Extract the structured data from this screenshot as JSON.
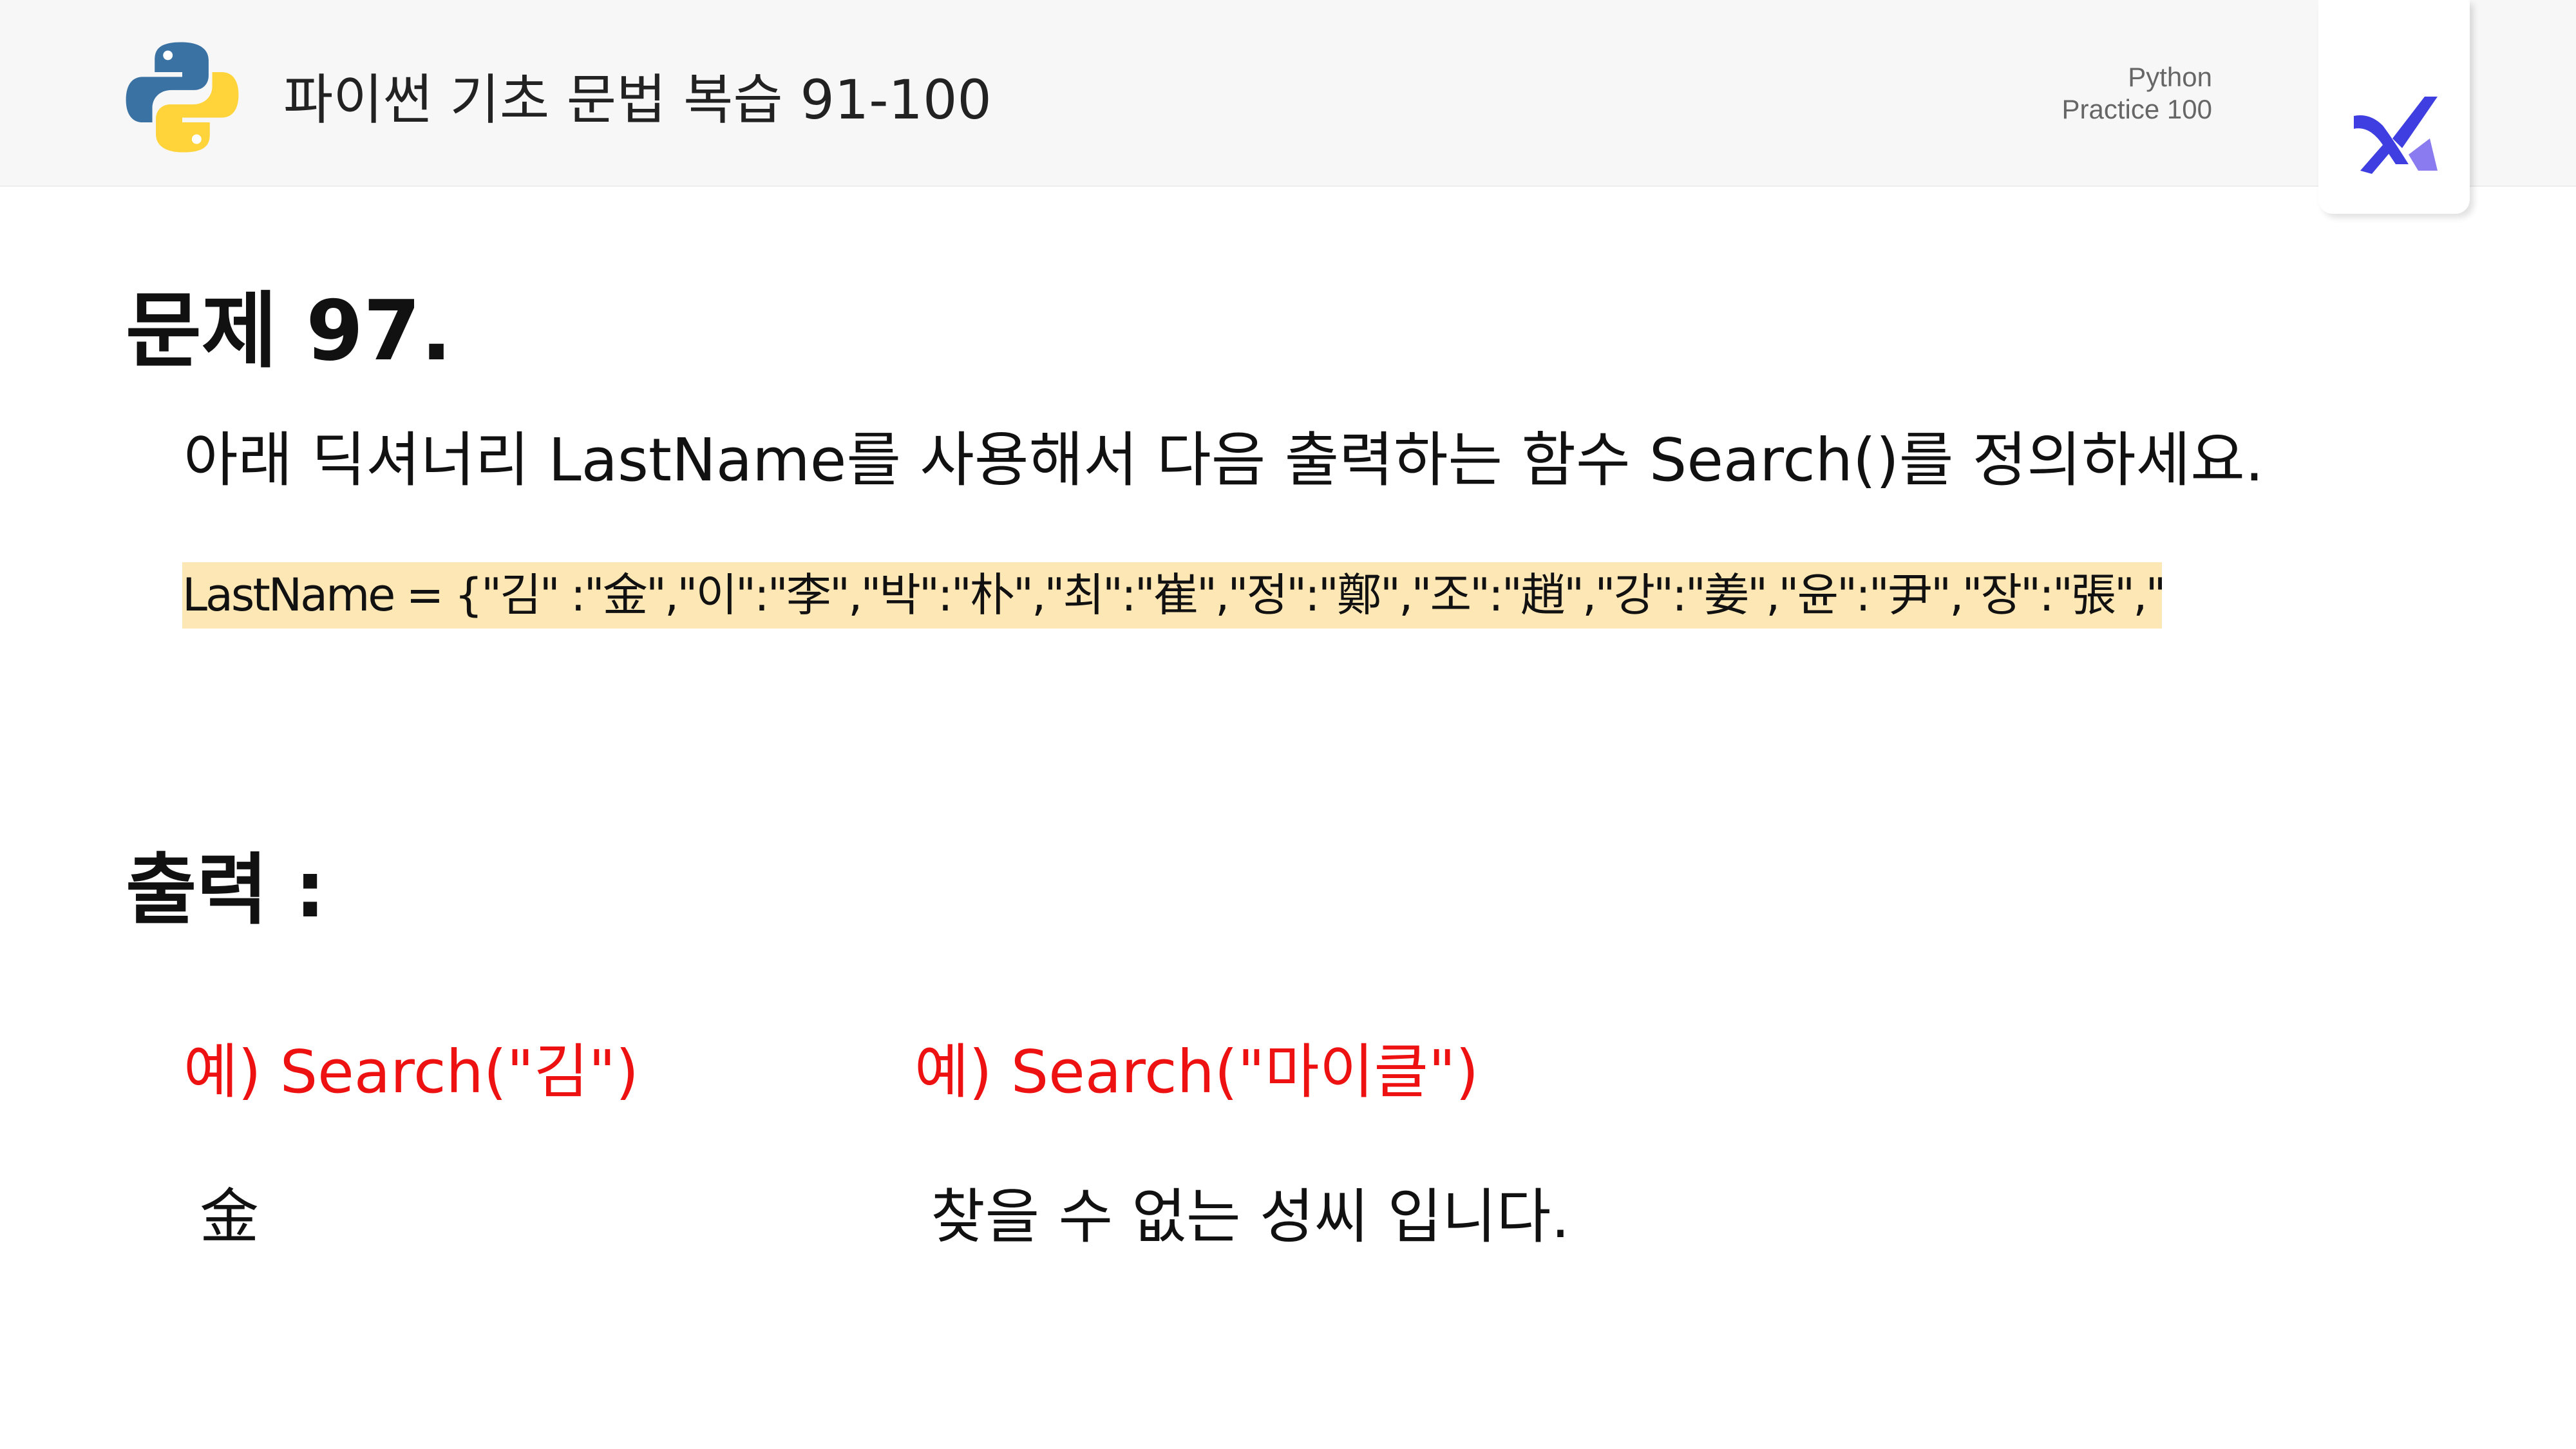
{
  "header": {
    "title": "파이썬 기초 문법 복습 91-100",
    "brand_line1": "Python",
    "brand_line2": "Practice 100",
    "colors": {
      "python_blue": "#3a72a4",
      "python_yellow": "#ffd43b",
      "badge_blue": "#3f3ee0"
    }
  },
  "problem": {
    "title": "문제 97.",
    "description": "아래 딕셔너리 LastName를 사용해서 다음 출력하는 함수 Search()를 정의하세요.",
    "code": "LastName = {\"김\" :\"金\",\"이\":\"李\",\"박\":\"朴\",\"최\":\"崔\",\"정\":\"鄭\",\"조\":\"趙\",\"강\":\"姜\",\"윤\":\"尹\",\"장\":\"張\",\"임\":\"林\"}",
    "code_highlight": "#fde7b4"
  },
  "output": {
    "title": "출력 :",
    "example1_call": "예) Search(\"김\")",
    "example1_result": "金",
    "example2_call": "예) Search(\"마이클\")",
    "example2_result": "찾을 수 없는 성씨 입니다.",
    "example_color": "#ee1111"
  }
}
